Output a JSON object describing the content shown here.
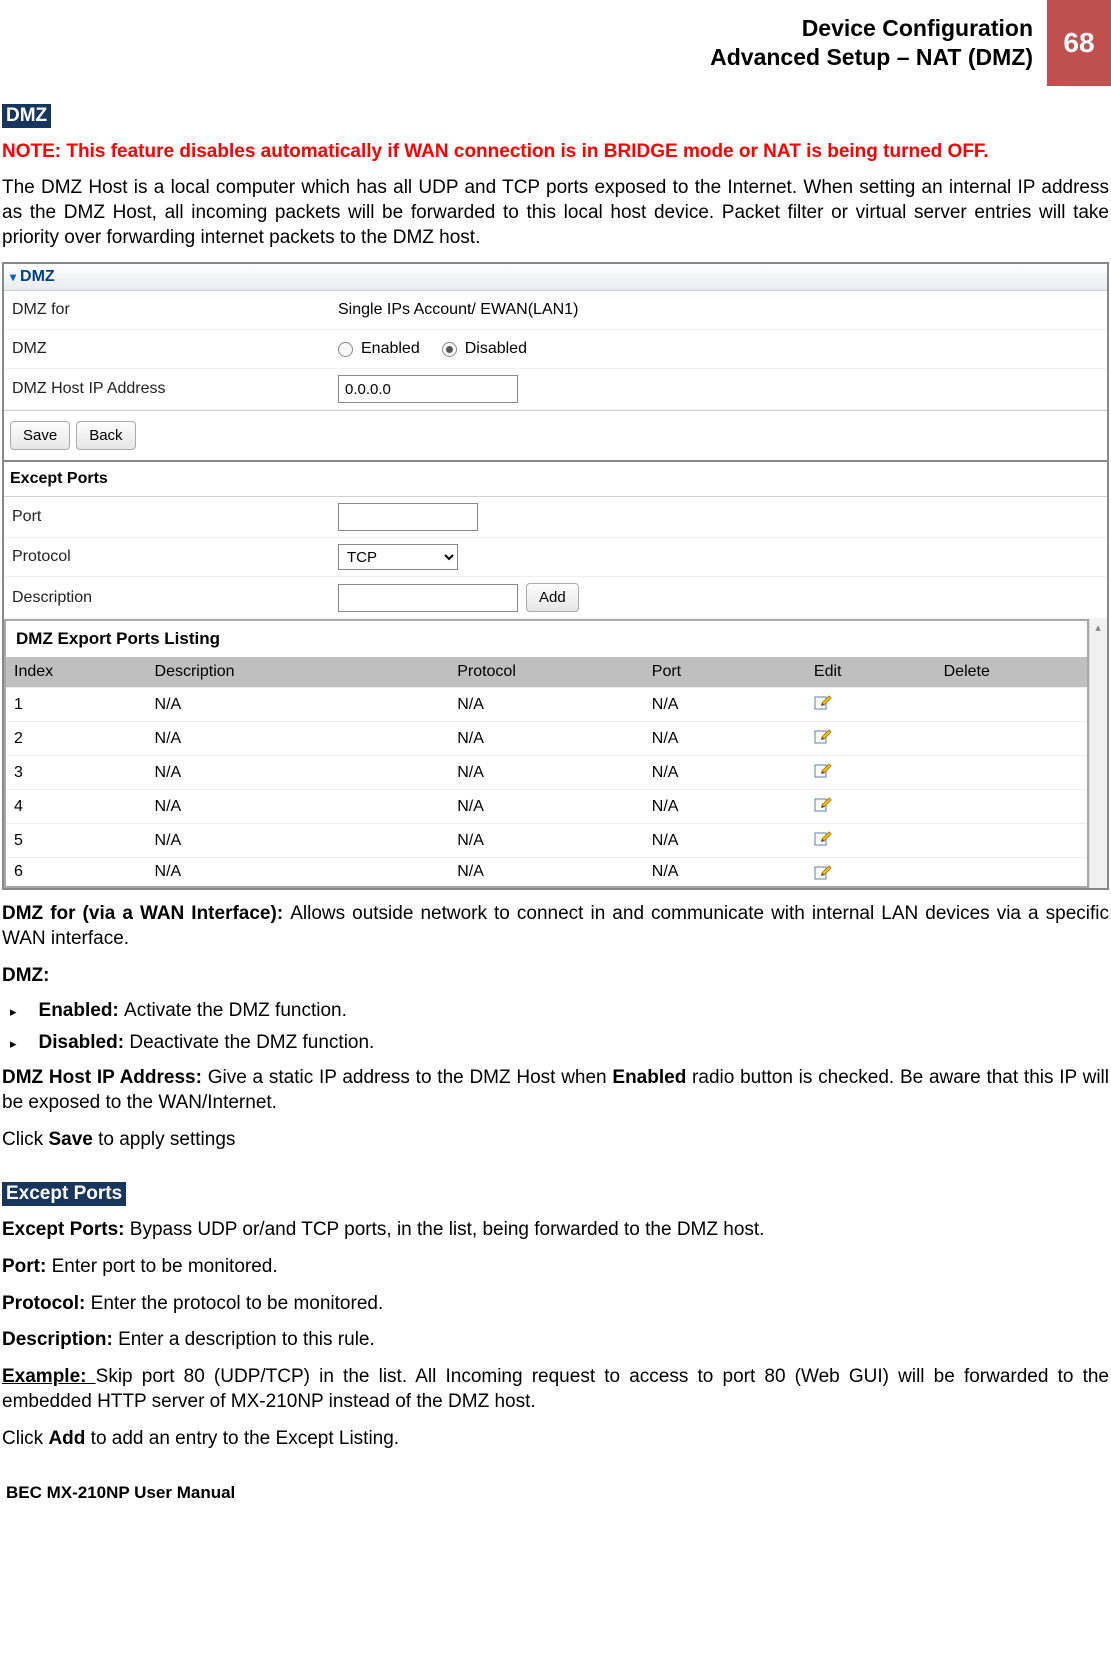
{
  "header": {
    "title_line1": "Device Configuration",
    "title_line2": "Advanced Setup – NAT (DMZ)",
    "page_number": "68"
  },
  "section_dmz_label": "DMZ",
  "note_text": "NOTE: This feature disables automatically if WAN connection is in BRIDGE mode or NAT is being turned OFF.",
  "intro_para": "The DMZ Host is a local computer which has all UDP and TCP ports exposed to the Internet. When setting an internal IP address as the DMZ Host, all incoming packets will be forwarded to this local host device.  Packet filter or virtual server entries will take priority over forwarding internet packets to the DMZ host.",
  "panel": {
    "title": "DMZ",
    "rows": {
      "dmz_for_label": "DMZ for",
      "dmz_for_value": "Single IPs Account/ EWAN(LAN1)",
      "dmz_label": "DMZ",
      "enabled_label": "Enabled",
      "disabled_label": "Disabled",
      "dmz_selected": "disabled",
      "host_ip_label": "DMZ Host IP Address",
      "host_ip_value": "0.0.0.0"
    },
    "buttons": {
      "save": "Save",
      "back": "Back"
    },
    "except_ports_header": "Except Ports",
    "port_label": "Port",
    "protocol_label": "Protocol",
    "protocol_value": "TCP",
    "description_label": "Description",
    "add_button": "Add",
    "listing_title": "DMZ Export Ports Listing",
    "listing_headers": {
      "index": "Index",
      "description": "Description",
      "protocol": "Protocol",
      "port": "Port",
      "edit": "Edit",
      "delete": "Delete"
    },
    "listing_rows": [
      {
        "index": "1",
        "description": "N/A",
        "protocol": "N/A",
        "port": "N/A"
      },
      {
        "index": "2",
        "description": "N/A",
        "protocol": "N/A",
        "port": "N/A"
      },
      {
        "index": "3",
        "description": "N/A",
        "protocol": "N/A",
        "port": "N/A"
      },
      {
        "index": "4",
        "description": "N/A",
        "protocol": "N/A",
        "port": "N/A"
      },
      {
        "index": "5",
        "description": "N/A",
        "protocol": "N/A",
        "port": "N/A"
      },
      {
        "index": "6",
        "description": "N/A",
        "protocol": "N/A",
        "port": "N/A"
      }
    ]
  },
  "desc": {
    "dmz_for_head": "DMZ for (via a WAN Interface): ",
    "dmz_for_body": "Allows outside network to connect in and communicate with internal LAN devices via a specific WAN interface.",
    "dmz_head": "DMZ:",
    "enabled_head": "Enabled: ",
    "enabled_body": "Activate the DMZ function.",
    "disabled_head": "Disabled: ",
    "disabled_body": "Deactivate the DMZ function.",
    "host_head": "DMZ Host IP Address: ",
    "host_body_1": "Give a static IP address to the DMZ Host when ",
    "host_body_bold": "Enabled",
    "host_body_2": " radio button is checked. Be aware that this IP will be exposed to the WAN/Internet.",
    "click_save_1": "Click ",
    "click_save_bold": "Save",
    "click_save_2": " to apply settings",
    "except_ports_label": "Except Ports",
    "except_ports_head": "Except Ports: ",
    "except_ports_body": "Bypass UDP or/and TCP ports, in the list, being forwarded to the DMZ host.",
    "port_head": "Port: ",
    "port_body": "Enter port to be monitored.",
    "protocol_head": "Protocol: ",
    "protocol_body": "Enter the protocol to be monitored.",
    "description_head": "Description: ",
    "description_body": "Enter a description to this rule.",
    "example_head": "Example: ",
    "example_body": "Skip port 80 (UDP/TCP) in the list.  All Incoming request to access to port 80 (Web GUI) will be forwarded to the embedded HTTP server of MX-210NP instead of the DMZ host.",
    "click_add_1": "Click ",
    "click_add_bold": "Add",
    "click_add_2": " to add an entry to the Except Listing."
  },
  "footer": "BEC MX-210NP User Manual"
}
